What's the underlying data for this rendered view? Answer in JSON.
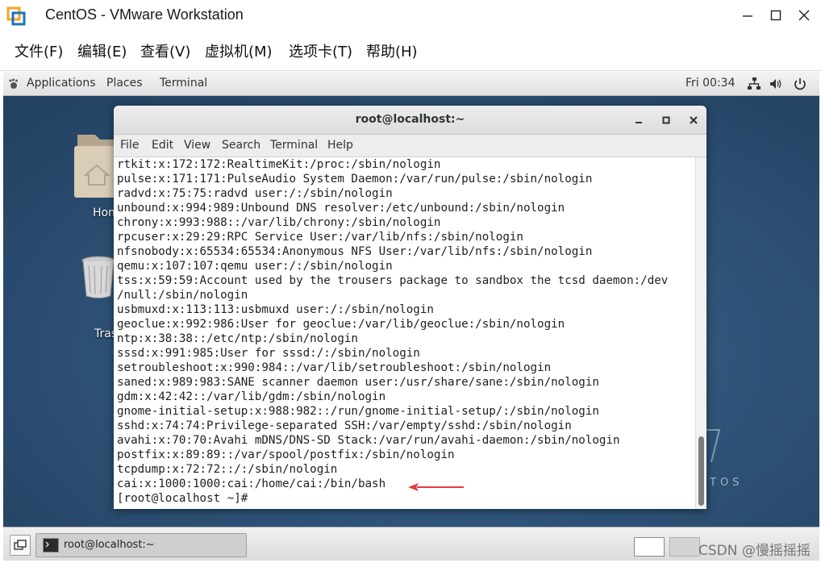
{
  "vmware": {
    "title": "CentOS - VMware Workstation",
    "menu": [
      "文件(F)",
      "编辑(E)",
      "查看(V)",
      "虚拟机(M)",
      "选项卡(T)",
      "帮助(H)"
    ]
  },
  "gnome_topbar": {
    "applications": "Applications",
    "places": "Places",
    "terminal": "Terminal",
    "clock": "Fri 00:34"
  },
  "desktop": {
    "home_label": "Hom",
    "trash_label": "Tras",
    "watermark": "TOS"
  },
  "terminal": {
    "title": "root@localhost:~",
    "menu": [
      "File",
      "Edit",
      "View",
      "Search",
      "Terminal",
      "Help"
    ],
    "lines": [
      "rtkit:x:172:172:RealtimeKit:/proc:/sbin/nologin",
      "pulse:x:171:171:PulseAudio System Daemon:/var/run/pulse:/sbin/nologin",
      "radvd:x:75:75:radvd user:/:/sbin/nologin",
      "unbound:x:994:989:Unbound DNS resolver:/etc/unbound:/sbin/nologin",
      "chrony:x:993:988::/var/lib/chrony:/sbin/nologin",
      "rpcuser:x:29:29:RPC Service User:/var/lib/nfs:/sbin/nologin",
      "nfsnobody:x:65534:65534:Anonymous NFS User:/var/lib/nfs:/sbin/nologin",
      "qemu:x:107:107:qemu user:/:/sbin/nologin",
      "tss:x:59:59:Account used by the trousers package to sandbox the tcsd daemon:/dev",
      "/null:/sbin/nologin",
      "usbmuxd:x:113:113:usbmuxd user:/:/sbin/nologin",
      "geoclue:x:992:986:User for geoclue:/var/lib/geoclue:/sbin/nologin",
      "ntp:x:38:38::/etc/ntp:/sbin/nologin",
      "sssd:x:991:985:User for sssd:/:/sbin/nologin",
      "setroubleshoot:x:990:984::/var/lib/setroubleshoot:/sbin/nologin",
      "saned:x:989:983:SANE scanner daemon user:/usr/share/sane:/sbin/nologin",
      "gdm:x:42:42::/var/lib/gdm:/sbin/nologin",
      "gnome-initial-setup:x:988:982::/run/gnome-initial-setup/:/sbin/nologin",
      "sshd:x:74:74:Privilege-separated SSH:/var/empty/sshd:/sbin/nologin",
      "avahi:x:70:70:Avahi mDNS/DNS-SD Stack:/var/run/avahi-daemon:/sbin/nologin",
      "postfix:x:89:89::/var/spool/postfix:/sbin/nologin",
      "tcpdump:x:72:72::/:/sbin/nologin",
      "cai:x:1000:1000:cai:/home/cai:/bin/bash",
      "[root@localhost ~]#"
    ],
    "arrow_color": "#e83a3a"
  },
  "taskbar": {
    "task_label": "root@localhost:~",
    "watermark": "CSDN @慢摇摇摇"
  }
}
